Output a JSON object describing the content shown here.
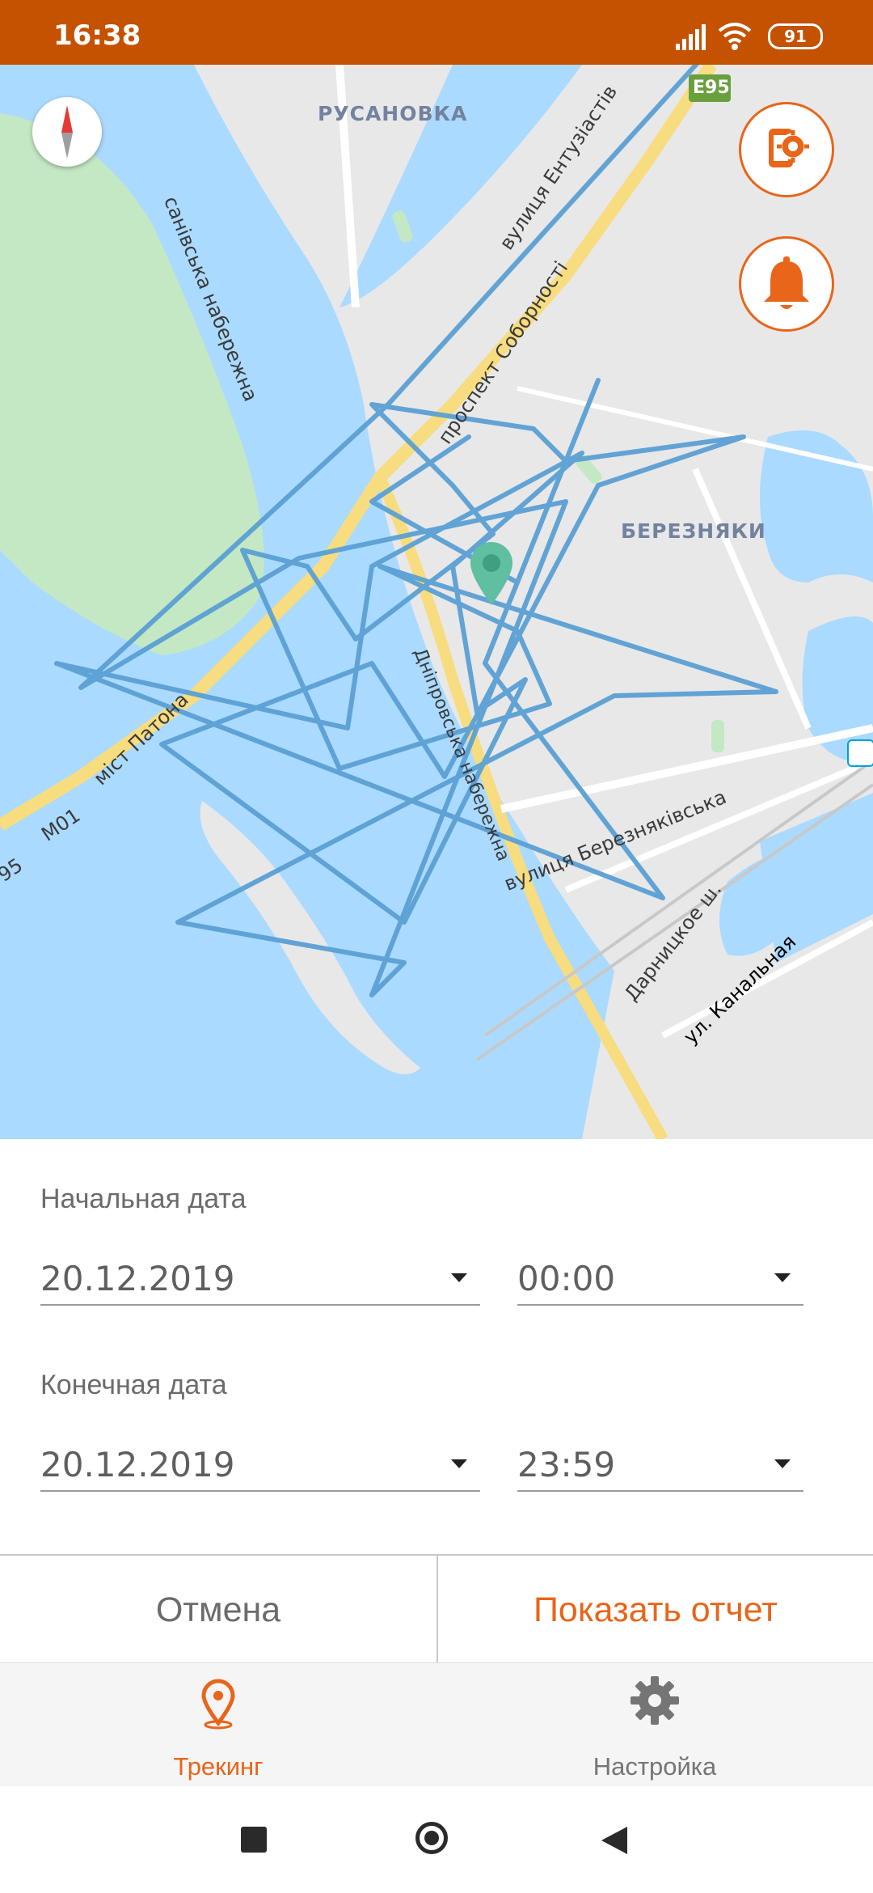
{
  "status_bar": {
    "time": "16:38",
    "battery": "91",
    "icons": [
      "signal-icon",
      "wifi-icon",
      "battery-icon"
    ],
    "background_color": "#c45200"
  },
  "map": {
    "labels": {
      "district_rusanovka": "РУСАНОВКА",
      "district_bereznyaky": "БЕРЕЗНЯКИ",
      "street_embankment_left": "санівська набережна",
      "street_entuziastiv": "вулиця Ентузіастів",
      "street_sobornosti": "проспект Соборності",
      "bridge_patona": "міст Патона",
      "route_m01": "M01",
      "route_e95_left": "95",
      "route_e95_shield": "E95",
      "street_dniprovska": "Дніпровська набережна",
      "street_bereznyakivska": "вулиця Березняківська",
      "street_darnytske": "Дарницкое ш.",
      "street_kanalna": "ул. Канальная"
    },
    "track_color": "#5a9fd4",
    "water_color": "#aadaff",
    "park_color": "#c4e8c4",
    "marker_color": "#5fbfa0"
  },
  "controls": {
    "compass": "compass-icon",
    "device_settings": "device-settings-icon",
    "alarm": "bell-icon",
    "accent_color": "#e8651a"
  },
  "form": {
    "start_label": "Начальная дата",
    "start_date": "20.12.2019",
    "start_time": "00:00",
    "end_label": "Конечная дата",
    "end_date": "20.12.2019",
    "end_time": "23:59"
  },
  "actions": {
    "cancel": "Отмена",
    "show_report": "Показать отчет"
  },
  "bottom_nav": {
    "items": [
      {
        "label": "Трекинг",
        "icon": "location-pin-icon",
        "active": true
      },
      {
        "label": "Настройка",
        "icon": "gear-icon",
        "active": false
      }
    ]
  },
  "system_nav": [
    "recents-icon",
    "home-icon",
    "back-icon"
  ]
}
